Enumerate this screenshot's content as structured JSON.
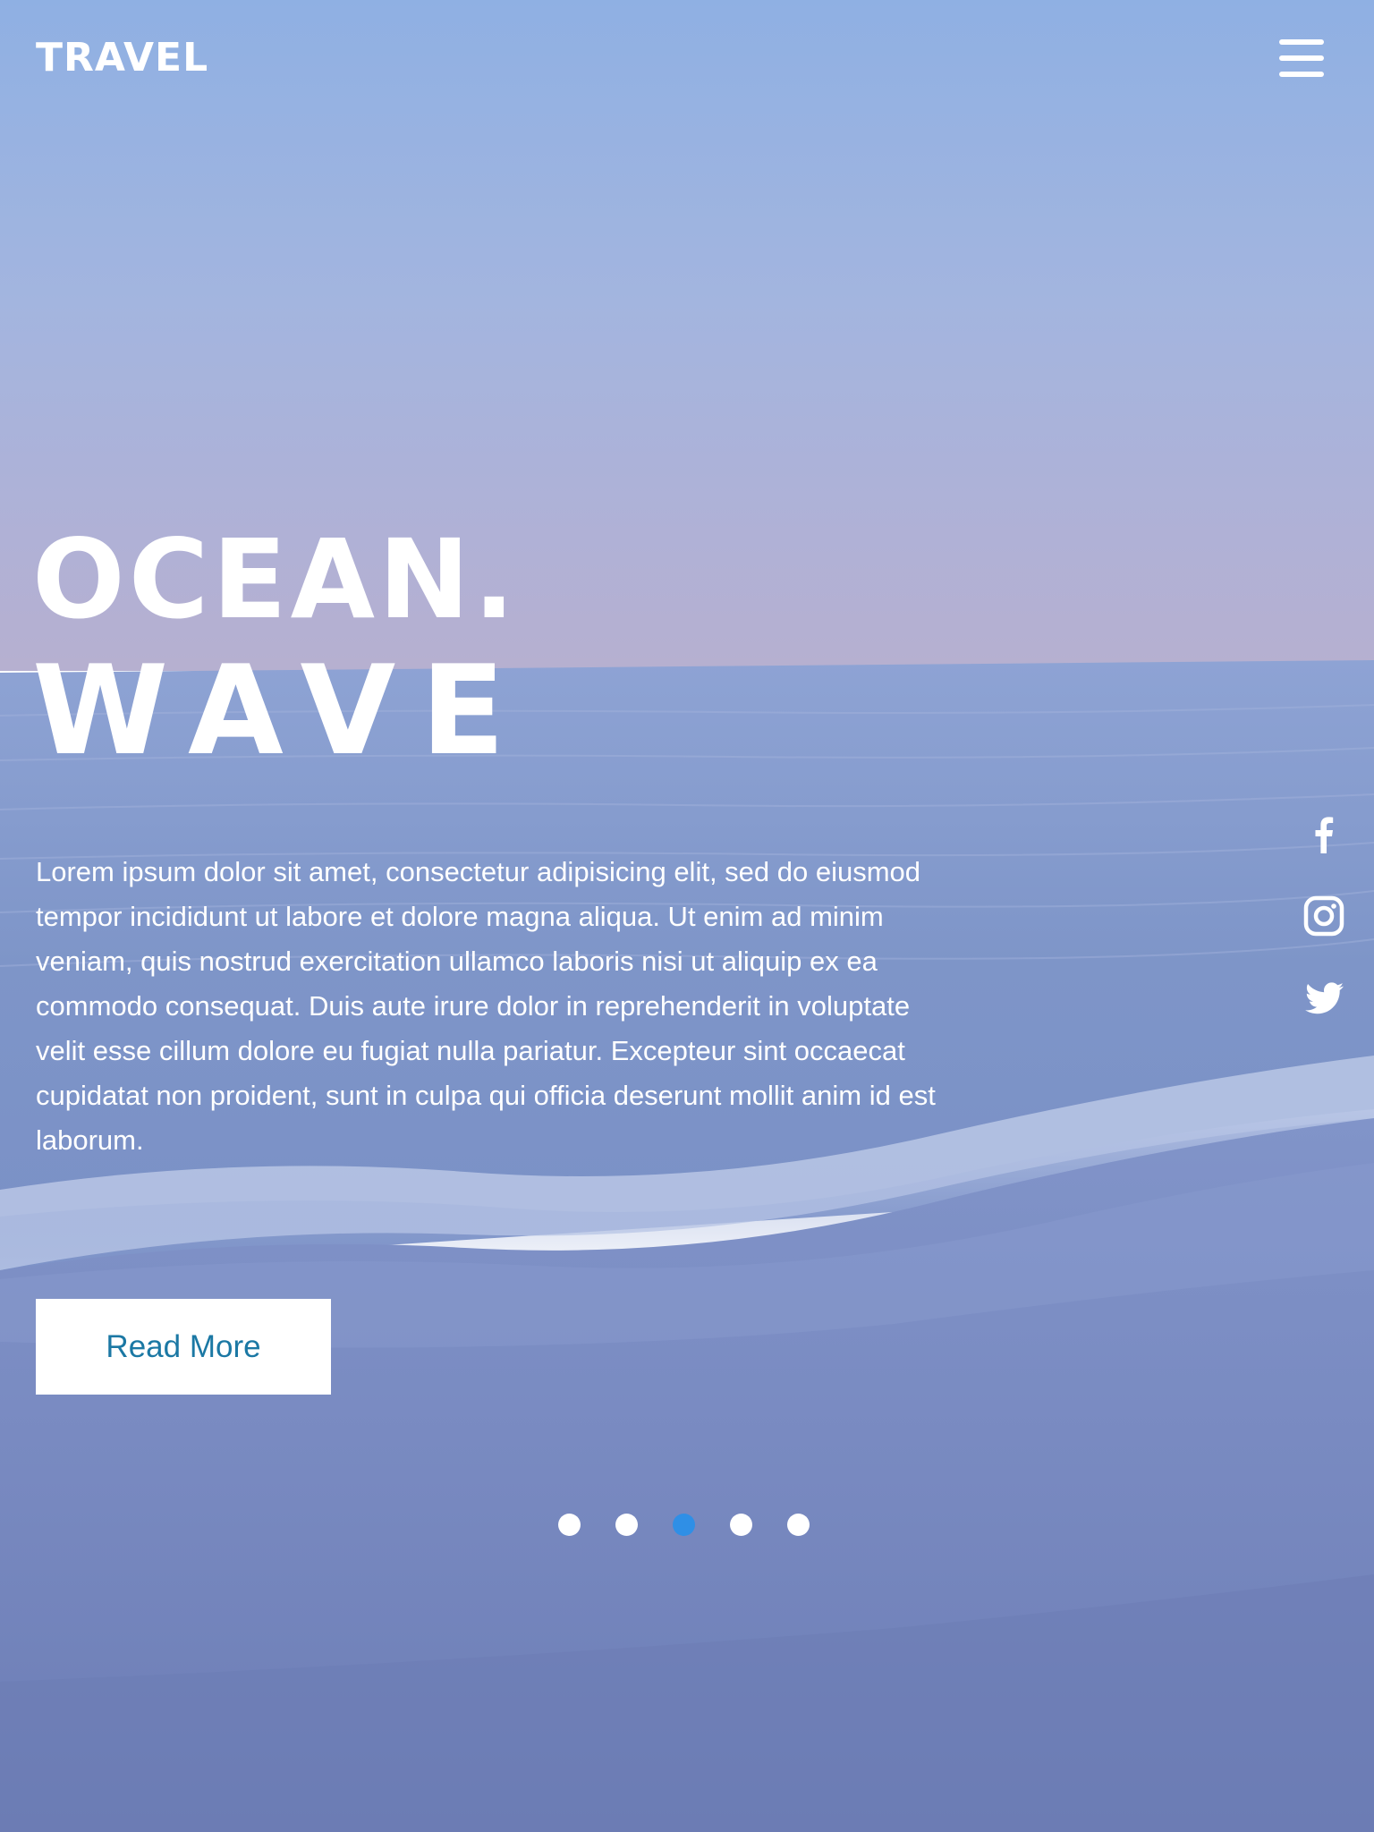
{
  "brand": {
    "logo_text": "TRAVEL"
  },
  "header": {
    "menu_icon": "hamburger-menu-icon"
  },
  "hero": {
    "title_line_1": "OCEAN.",
    "title_line_2": "WAVE",
    "description": "Lorem ipsum dolor sit amet, consectetur adipisicing elit, sed do eiusmod tempor incididunt ut labore et dolore magna aliqua. Ut enim ad minim veniam, quis nostrud exercitation ullamco laboris nisi ut aliquip ex ea commodo consequat. Duis aute irure dolor in reprehenderit in voluptate velit esse cillum dolore eu fugiat nulla pariatur. Excepteur sint occaecat cupidatat non proident, sunt in culpa qui officia deserunt mollit anim id est laborum.",
    "button_label": "Read More"
  },
  "social": [
    {
      "name": "facebook",
      "icon": "facebook-icon"
    },
    {
      "name": "instagram",
      "icon": "instagram-icon"
    },
    {
      "name": "twitter",
      "icon": "twitter-icon"
    }
  ],
  "carousel": {
    "total_slides": 5,
    "active_slide": 3
  },
  "colors": {
    "button_text": "#1b78a4",
    "active_dot": "#2f8fe6",
    "inactive_dot": "#ffffff",
    "sky_top": "#8fb0e3",
    "sky_horizon": "#b3b1d3",
    "sea": "#7f96c9",
    "sand": "#7488c0"
  }
}
